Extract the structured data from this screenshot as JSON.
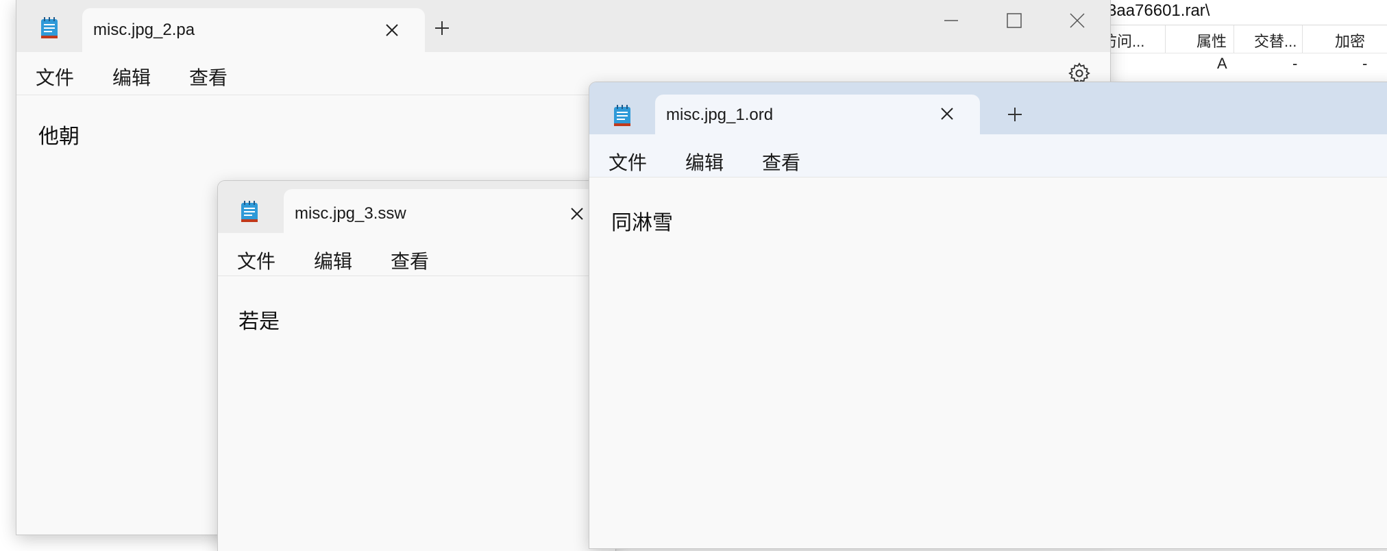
{
  "archive": {
    "path": "3aa76601.rar\\",
    "columns": [
      "访问...",
      "属性",
      "交替...",
      "加密"
    ],
    "row": [
      "A",
      "-",
      "-"
    ]
  },
  "windows": [
    {
      "id": "notepad-2",
      "tab_title": "misc.jpg_2.pa",
      "menu": [
        "文件",
        "编辑",
        "查看"
      ],
      "content": "他朝"
    },
    {
      "id": "notepad-3",
      "tab_title": "misc.jpg_3.ssw",
      "menu": [
        "文件",
        "编辑",
        "查看"
      ],
      "content": "若是"
    },
    {
      "id": "notepad-1",
      "tab_title": "misc.jpg_1.ord",
      "menu": [
        "文件",
        "编辑",
        "查看"
      ],
      "content": "同淋雪"
    }
  ],
  "icons": {
    "app": "notepad-icon",
    "close": "close-icon",
    "new_tab": "plus-icon",
    "settings": "gear-icon",
    "minimize": "minimize-icon",
    "maximize": "maximize-icon"
  }
}
